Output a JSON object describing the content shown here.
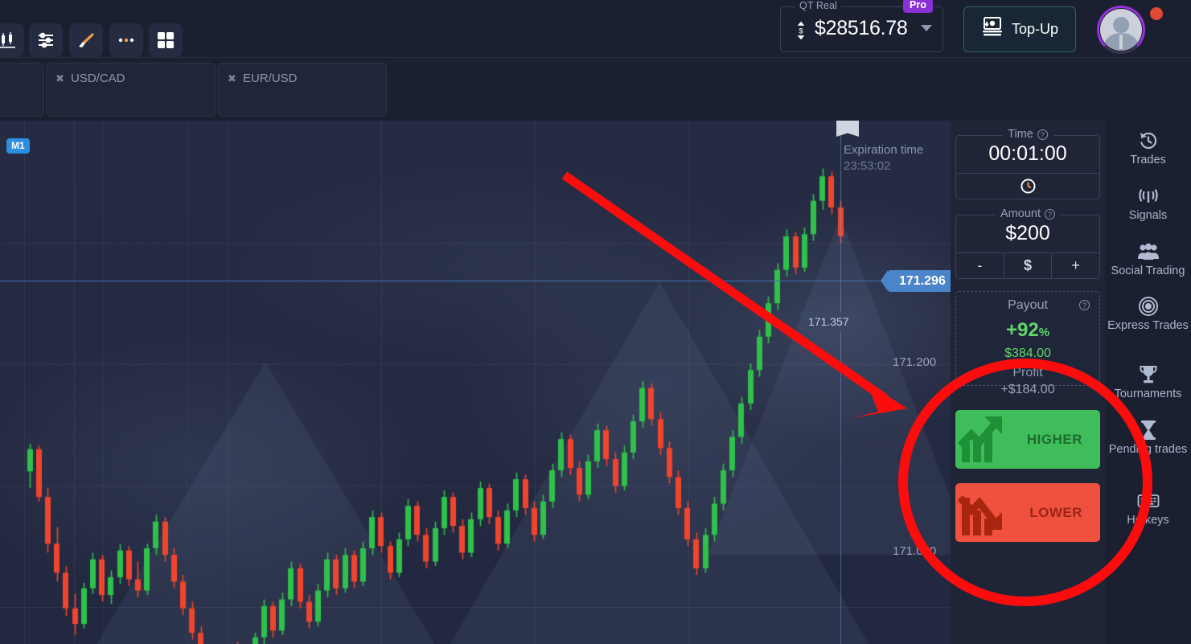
{
  "topbar": {
    "account_label": "QT Real",
    "pro_badge": "Pro",
    "balance": "$28516.78",
    "topup_label": "Top-Up",
    "balance_icon": "updown-dollar-icon",
    "topup_icon": "cash-withdraw-icon",
    "avatar_icon": "user-avatar-icon",
    "notification_icon": "notification-dot-icon",
    "dropdown_icon": "caret-down-icon"
  },
  "tabs": {
    "items": [
      {
        "label": "",
        "close_icon": "close-icon"
      },
      {
        "label": "USD/CAD",
        "close_icon": "close-icon"
      },
      {
        "label": "EUR/USD",
        "close_icon": "close-icon"
      }
    ],
    "next_icon": "chevron-right-icon"
  },
  "chart_toolbar": {
    "timeframe_badge": "M1",
    "tools": [
      {
        "name": "candlestick-chart-type-icon"
      },
      {
        "name": "indicators-sliders-icon"
      },
      {
        "name": "brush-drawing-icon"
      },
      {
        "name": "more-options-icon"
      },
      {
        "name": "layout-grid-icon"
      }
    ]
  },
  "chart": {
    "expiration_title": "Expiration time",
    "expiration_time": "23:53:02",
    "current_price": "171.296",
    "high_marker_price": "171.357",
    "price_ticks": [
      "171.200",
      "171.000"
    ],
    "colors": {
      "bull": "#2fc14a",
      "bear": "#f0452c",
      "price_line": "#4a84c9",
      "background": "#232940"
    }
  },
  "trade_panel": {
    "time": {
      "legend": "Time",
      "value": "00:01:00",
      "clock_icon": "clock-icon",
      "help_icon": "help-circle-icon"
    },
    "amount": {
      "legend": "Amount",
      "value": "$200",
      "help_icon": "help-circle-icon",
      "minus_label": "-",
      "currency_label": "$",
      "plus_label": "+"
    },
    "payout": {
      "title": "Payout",
      "help_icon": "help-circle-icon",
      "percent": "+92",
      "percent_unit": "%",
      "amount": "$384.00",
      "profit_label": "Profit",
      "profit_amount": "+$184.00"
    },
    "higher_label": "HIGHER",
    "lower_label": "LOWER",
    "higher_icon": "trend-up-arrow-icon",
    "lower_icon": "trend-down-arrow-icon"
  },
  "right_nav": {
    "items": [
      {
        "label": "Trades",
        "icon": "history-clock-icon"
      },
      {
        "label": "Signals",
        "icon": "signal-antenna-icon"
      },
      {
        "label": "Social Trading",
        "icon": "people-group-icon"
      },
      {
        "label": "Express Trades",
        "icon": "target-rings-icon"
      },
      {
        "label": "Tournaments",
        "icon": "trophy-icon"
      },
      {
        "label": "Pending trades",
        "icon": "hourglass-icon"
      },
      {
        "label": "Hotkeys",
        "icon": "keyboard-icon"
      }
    ]
  },
  "annotations": {
    "color": "#fc0d0d",
    "arrow_name": "red-arrow-annotation",
    "circle_name": "red-circle-annotation"
  },
  "chart_data": {
    "type": "candlestick",
    "title": "",
    "xlabel": "",
    "ylabel": "",
    "ylim": [
      170.93,
      171.4
    ],
    "ytick_values": [
      171.2,
      171.0
    ],
    "current_price": 171.296,
    "high_marker": 171.357,
    "bull_color": "#2fc14a",
    "bear_color": "#f0452c",
    "candles": [
      [
        171.085,
        171.11,
        171.07,
        171.105
      ],
      [
        171.105,
        171.108,
        171.058,
        171.062
      ],
      [
        171.062,
        171.07,
        171.012,
        171.02
      ],
      [
        171.02,
        171.035,
        170.986,
        170.994
      ],
      [
        170.994,
        171.0,
        170.955,
        170.962
      ],
      [
        170.962,
        170.975,
        170.938,
        170.948
      ],
      [
        170.948,
        170.985,
        170.944,
        170.98
      ],
      [
        170.98,
        171.012,
        170.975,
        171.006
      ],
      [
        171.006,
        171.01,
        170.968,
        170.974
      ],
      [
        170.974,
        170.996,
        170.966,
        170.99
      ],
      [
        170.99,
        171.02,
        170.984,
        171.014
      ],
      [
        171.014,
        171.018,
        170.982,
        170.988
      ],
      [
        170.988,
        171.004,
        170.972,
        170.978
      ],
      [
        170.978,
        171.02,
        170.974,
        171.016
      ],
      [
        171.016,
        171.046,
        171.01,
        171.04
      ],
      [
        171.04,
        171.044,
        171.004,
        171.01
      ],
      [
        171.01,
        171.016,
        170.98,
        170.986
      ],
      [
        170.986,
        170.992,
        170.956,
        170.962
      ],
      [
        170.962,
        170.968,
        170.934,
        170.94
      ],
      [
        170.94,
        170.946,
        170.918,
        170.924
      ],
      [
        170.924,
        170.93,
        170.905,
        170.91
      ],
      [
        170.91,
        170.916,
        170.898,
        170.902
      ],
      [
        170.902,
        170.93,
        170.898,
        170.926
      ],
      [
        170.926,
        170.932,
        170.912,
        170.918
      ],
      [
        170.918,
        170.924,
        170.9,
        170.906
      ],
      [
        170.906,
        170.94,
        170.902,
        170.936
      ],
      [
        170.936,
        170.97,
        170.93,
        170.964
      ],
      [
        170.964,
        170.968,
        170.936,
        170.942
      ],
      [
        170.942,
        170.976,
        170.938,
        170.97
      ],
      [
        170.97,
        171.004,
        170.964,
        170.998
      ],
      [
        170.998,
        171.002,
        170.962,
        170.968
      ],
      [
        170.968,
        170.974,
        170.944,
        170.95
      ],
      [
        170.95,
        170.984,
        170.946,
        170.978
      ],
      [
        170.978,
        171.012,
        170.972,
        171.006
      ],
      [
        171.006,
        171.01,
        170.974,
        170.98
      ],
      [
        170.98,
        171.016,
        170.976,
        171.01
      ],
      [
        171.01,
        171.014,
        170.98,
        170.986
      ],
      [
        170.986,
        171.022,
        170.982,
        171.016
      ],
      [
        171.016,
        171.05,
        171.01,
        171.044
      ],
      [
        171.044,
        171.048,
        171.012,
        171.018
      ],
      [
        171.018,
        171.022,
        170.988,
        170.994
      ],
      [
        170.994,
        171.03,
        170.99,
        171.024
      ],
      [
        171.024,
        171.06,
        171.018,
        171.054
      ],
      [
        171.054,
        171.058,
        171.022,
        171.028
      ],
      [
        171.028,
        171.034,
        170.998,
        171.004
      ],
      [
        171.004,
        171.04,
        171.0,
        171.034
      ],
      [
        171.034,
        171.068,
        171.028,
        171.062
      ],
      [
        171.062,
        171.066,
        171.03,
        171.036
      ],
      [
        171.036,
        171.042,
        171.006,
        171.012
      ],
      [
        171.012,
        171.048,
        171.008,
        171.042
      ],
      [
        171.042,
        171.076,
        171.036,
        171.07
      ],
      [
        171.07,
        171.074,
        171.038,
        171.044
      ],
      [
        171.044,
        171.05,
        171.014,
        171.02
      ],
      [
        171.02,
        171.056,
        171.016,
        171.05
      ],
      [
        171.05,
        171.084,
        171.044,
        171.078
      ],
      [
        171.078,
        171.082,
        171.046,
        171.052
      ],
      [
        171.052,
        171.058,
        171.022,
        171.028
      ],
      [
        171.028,
        171.064,
        171.024,
        171.058
      ],
      [
        171.058,
        171.092,
        171.052,
        171.086
      ],
      [
        171.086,
        171.12,
        171.08,
        171.114
      ],
      [
        171.114,
        171.118,
        171.082,
        171.088
      ],
      [
        171.088,
        171.094,
        171.058,
        171.064
      ],
      [
        171.064,
        171.1,
        171.06,
        171.094
      ],
      [
        171.094,
        171.128,
        171.088,
        171.122
      ],
      [
        171.122,
        171.126,
        171.09,
        171.096
      ],
      [
        171.096,
        171.102,
        171.066,
        171.072
      ],
      [
        171.072,
        171.108,
        171.068,
        171.102
      ],
      [
        171.102,
        171.136,
        171.096,
        171.13
      ],
      [
        171.13,
        171.166,
        171.124,
        171.16
      ],
      [
        171.16,
        171.164,
        171.126,
        171.132
      ],
      [
        171.132,
        171.138,
        171.1,
        171.106
      ],
      [
        171.106,
        171.112,
        171.074,
        171.08
      ],
      [
        171.08,
        171.086,
        171.046,
        171.052
      ],
      [
        171.052,
        171.058,
        171.018,
        171.024
      ],
      [
        171.024,
        171.03,
        170.992,
        170.998
      ],
      [
        170.998,
        171.034,
        170.994,
        171.028
      ],
      [
        171.028,
        171.062,
        171.022,
        171.056
      ],
      [
        171.056,
        171.092,
        171.05,
        171.086
      ],
      [
        171.086,
        171.122,
        171.08,
        171.116
      ],
      [
        171.116,
        171.152,
        171.11,
        171.146
      ],
      [
        171.146,
        171.182,
        171.14,
        171.176
      ],
      [
        171.176,
        171.212,
        171.17,
        171.206
      ],
      [
        171.206,
        171.242,
        171.2,
        171.236
      ],
      [
        171.236,
        171.272,
        171.23,
        171.266
      ],
      [
        171.266,
        171.302,
        171.26,
        171.296
      ],
      [
        171.296,
        171.3,
        171.262,
        171.268
      ],
      [
        171.268,
        171.304,
        171.264,
        171.298
      ],
      [
        171.298,
        171.334,
        171.292,
        171.328
      ],
      [
        171.328,
        171.357,
        171.32,
        171.35
      ],
      [
        171.35,
        171.354,
        171.316,
        171.322
      ],
      [
        171.322,
        171.328,
        171.29,
        171.296
      ]
    ]
  }
}
